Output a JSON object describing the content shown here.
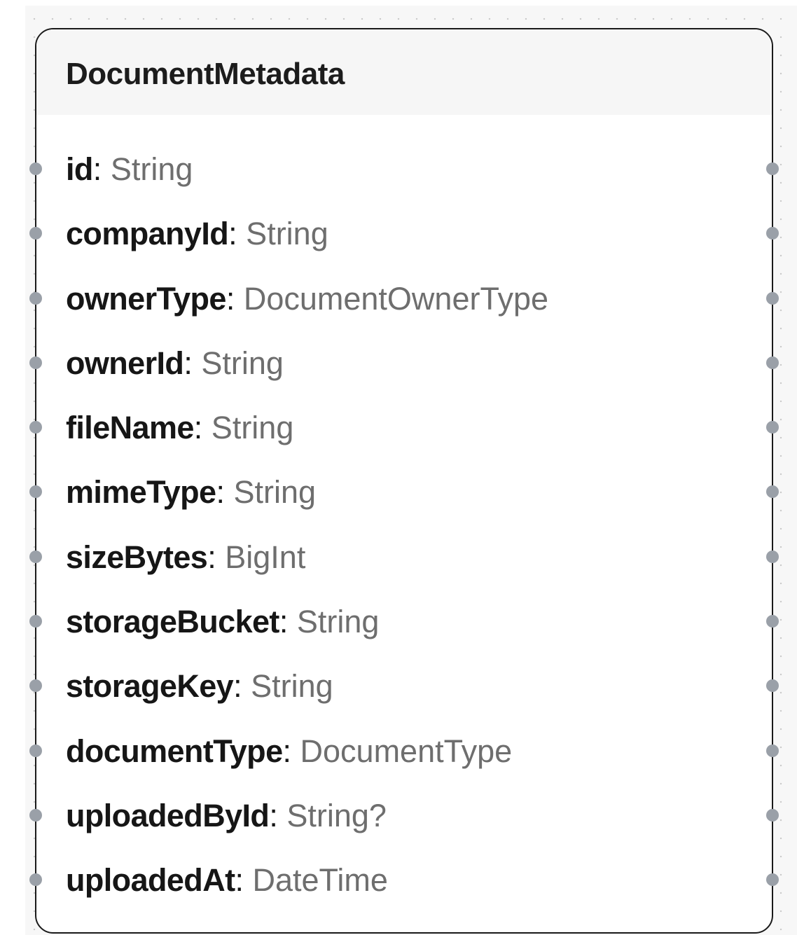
{
  "model": {
    "name": "DocumentMetadata",
    "fields": [
      {
        "name": "id",
        "sep": ":",
        "type": " String"
      },
      {
        "name": "companyId",
        "sep": ":",
        "type": " String"
      },
      {
        "name": "ownerType",
        "sep": ":",
        "type": " DocumentOwnerType"
      },
      {
        "name": "ownerId",
        "sep": ":",
        "type": " String"
      },
      {
        "name": "fileName",
        "sep": ":",
        "type": " String"
      },
      {
        "name": "mimeType",
        "sep": ":",
        "type": " String"
      },
      {
        "name": "sizeBytes",
        "sep": ":",
        "type": " BigInt"
      },
      {
        "name": "storageBucket",
        "sep": ":",
        "type": " String"
      },
      {
        "name": "storageKey",
        "sep": ":",
        "type": " String"
      },
      {
        "name": "documentType",
        "sep": ":",
        "type": " DocumentType"
      },
      {
        "name": "uploadedById",
        "sep": ":",
        "type": " String?"
      },
      {
        "name": "uploadedAt",
        "sep": ":",
        "type": " DateTime"
      }
    ]
  },
  "colors": {
    "canvas_background": "#f7f7f7",
    "node_border": "#1a1a1a",
    "header_background": "#f6f6f6",
    "field_name": "#161616",
    "field_type": "#6e6e6e",
    "handle": "#9aa0a8"
  }
}
